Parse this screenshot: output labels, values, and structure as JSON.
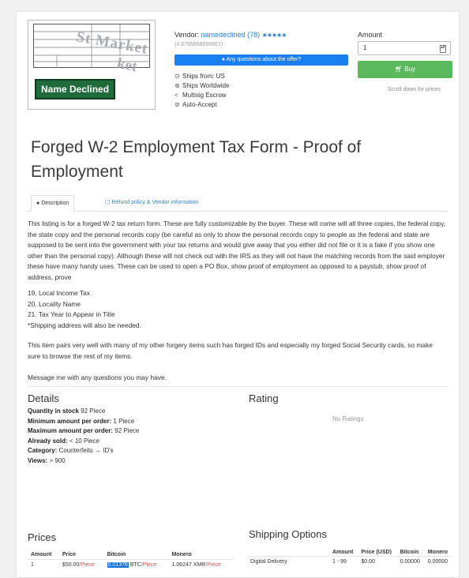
{
  "product_image": {
    "watermark_a": "St Market",
    "watermark_b": "ket",
    "caption": "Name Declined"
  },
  "vendor": {
    "label": "Vendor:",
    "name": "namedeclined",
    "count": "(78)",
    "stars": "★★★★★",
    "pgp_line": "(4.8766666666667)"
  },
  "questions_button": "Any questions about the offer?",
  "features": [
    {
      "icon": "globe-icon",
      "glyph": "⊙",
      "text": "Ships from: US"
    },
    {
      "icon": "worldwide-icon",
      "glyph": "⊛",
      "text": "Ships Worldwide"
    },
    {
      "icon": "share-icon",
      "glyph": "<",
      "text": "Multisig Escrow"
    },
    {
      "icon": "check-icon",
      "glyph": "⊘",
      "text": "Auto-Accept"
    }
  ],
  "purchase": {
    "amount_label": "Amount",
    "amount_value": "1",
    "buy_label": "Buy",
    "scroll_note": "Scroll down for prices"
  },
  "title": "Forged W-2 Employment Tax Form - Proof of Employment",
  "tabs": {
    "description": "Description",
    "refund": "Refund policy & Vendor information"
  },
  "description": {
    "paragraph": "This listing is for a forged W-2 tax return form. These are fully customizable by the buyer. These will come will all three copies, the federal copy, the state copy and the personal records copy (be careful as only to show the personal records copy to people as the federal and state are supposed to be sent into the government with your tax returns and would give away that you either did not file or it is a fake if you show one other than the personal copy). Although these will not check out with the IRS as they will not have the matching records from the said employer these have many handy uses. These can be used to open a PO Box, show proof of employment as opposed to a paystub, show proof of address, prove",
    "list": [
      "19. Local Income Tax",
      "20. Locality Name",
      "21. Tax Year to Appear in Title",
      "*Shipping address will also be needed."
    ],
    "pairs": "This item pairs very well with many of my other forgery items such has forged IDs and especially my forged Social Security cards, so make sure to browse the rest of my items.",
    "message": "Message me with any questions you may have."
  },
  "details": {
    "heading": "Details",
    "rows": [
      {
        "label": "Quantity in stock",
        "value": "92 Piece"
      },
      {
        "label": "Minimum amount per order:",
        "value": "1 Piece"
      },
      {
        "label": "Maximum amount per order:",
        "value": "92 Piece"
      },
      {
        "label": "Already sold:",
        "value": "< 10 Piece"
      },
      {
        "label": "Category:",
        "value": "Counterfeits → ID's"
      },
      {
        "label": "Views:",
        "value": "> 900"
      }
    ]
  },
  "rating": {
    "heading": "Rating",
    "empty": "No Ratings"
  },
  "prices": {
    "heading": "Prices",
    "columns": [
      "Amount",
      "Price",
      "Bitcoin",
      "Monero"
    ],
    "row": {
      "amount": "1",
      "price": "$50.00",
      "unit": "/Piece",
      "btc": "0.01376",
      "btc_unit": "BTC",
      "xmr": "1.06247 XMR",
      "xmr_unit": "/Piece"
    }
  },
  "shipping": {
    "heading": "Shipping Options",
    "columns": [
      "",
      "Amount",
      "Price (USD)",
      "Bitcoin",
      "Monero"
    ],
    "row": {
      "name": "Digital Delivery",
      "amount": "1 - 99",
      "price": "$0.00",
      "btc": "0.00000",
      "xmr": "0.00000"
    }
  },
  "colors": {
    "accent": "#1a7ff0",
    "buy": "#5cb85c",
    "link": "#2a7fd4",
    "name_tag": "#1f6b3b"
  }
}
